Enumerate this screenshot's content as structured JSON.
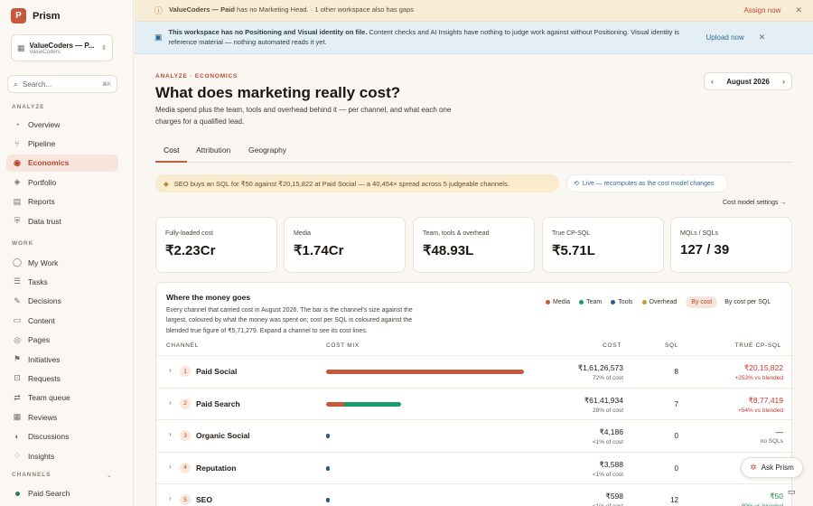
{
  "app": {
    "name": "Prism",
    "logo_letter": "P"
  },
  "workspace": {
    "name": "ValueCoders — P...",
    "sub": "ValueCoders"
  },
  "search": {
    "placeholder": "Search...",
    "shortcut": "⌘K"
  },
  "sidebar": {
    "analyze_label": "ANALYZE",
    "analyze": [
      {
        "label": "Overview",
        "icon": "overview-icon",
        "glyph": "◔"
      },
      {
        "label": "Pipeline",
        "icon": "pipeline-icon",
        "glyph": "⑂"
      },
      {
        "label": "Economics",
        "icon": "economics-icon",
        "glyph": "◉",
        "active": true
      },
      {
        "label": "Portfolio",
        "icon": "portfolio-icon",
        "glyph": "◈"
      },
      {
        "label": "Reports",
        "icon": "reports-icon",
        "glyph": "▤"
      },
      {
        "label": "Data trust",
        "icon": "shield-icon",
        "glyph": "⛨"
      }
    ],
    "work_label": "WORK",
    "work": [
      {
        "label": "My Work",
        "icon": "user-icon",
        "glyph": "◯"
      },
      {
        "label": "Tasks",
        "icon": "tasks-icon",
        "glyph": "☰"
      },
      {
        "label": "Decisions",
        "icon": "decisions-icon",
        "glyph": "✎"
      },
      {
        "label": "Content",
        "icon": "content-icon",
        "glyph": "▭"
      },
      {
        "label": "Pages",
        "icon": "pages-icon",
        "glyph": "◎"
      },
      {
        "label": "Initiatives",
        "icon": "initiatives-icon",
        "glyph": "⚑"
      },
      {
        "label": "Requests",
        "icon": "requests-icon",
        "glyph": "⊡"
      },
      {
        "label": "Team queue",
        "icon": "team-queue-icon",
        "glyph": "⇄"
      },
      {
        "label": "Reviews",
        "icon": "reviews-icon",
        "glyph": "▦"
      },
      {
        "label": "Discussions",
        "icon": "discussions-icon",
        "glyph": "◐"
      },
      {
        "label": "Insights",
        "icon": "insights-icon",
        "glyph": "♢"
      }
    ],
    "channels_label": "CHANNELS",
    "channels": [
      {
        "label": "Paid Search",
        "color": "#2f7d5a"
      }
    ]
  },
  "banners": {
    "warning": {
      "bold": "ValueCoders — Paid",
      "text": " has no Marketing Head. · 1 other workspace also has gaps",
      "action": "Assign now",
      "icon": "warning-icon"
    },
    "info": {
      "bold": "This workspace has no Positioning and Visual identity on file.",
      "text": " Content checks and AI Insights have nothing to judge work against without Positioning. Visual identity is reference material — nothing automated reads it yet.",
      "action": "Upload now",
      "icon": "info-icon"
    }
  },
  "page": {
    "breadcrumb": "ANALYZE · ECONOMICS",
    "title": "What does marketing really cost?",
    "subtitle": "Media spend plus the team, tools and overhead behind it — per channel, and what each one charges for a qualified lead.",
    "month": "August 2026"
  },
  "tabs": [
    "Cost",
    "Attribution",
    "Geography"
  ],
  "insight": "SEO buys an SQL for ₹50 against ₹20,15,822 at Paid Social — a 40,454× spread across 5 judgeable channels.",
  "live": "Live — recomputes as the cost model changes",
  "cost_model_link": "Cost model settings →",
  "kpis": [
    {
      "label": "Fully-loaded cost",
      "value": "₹2.23Cr"
    },
    {
      "label": "Media",
      "value": "₹1.74Cr"
    },
    {
      "label": "Team, tools & overhead",
      "value": "₹48.93L"
    },
    {
      "label": "True CP-SQL",
      "value": "₹5.71L"
    },
    {
      "label": "MQLs / SQLs",
      "value": "127 / 39"
    }
  ],
  "money": {
    "title": "Where the money goes",
    "desc": "Every channel that carried cost in August 2026. The bar is the channel's size against the largest, coloured by what the money was spent on; cost per SQL is coloured against the blended true figure of ₹5,71,279. Expand a channel to see its cost lines.",
    "legend": [
      {
        "label": "Media",
        "color": "#c8583c"
      },
      {
        "label": "Team",
        "color": "#1d9a6c"
      },
      {
        "label": "Tools",
        "color": "#1f5f8f"
      },
      {
        "label": "Overhead",
        "color": "#c89a2e"
      }
    ],
    "toggle": [
      "By cost",
      "By cost per SQL"
    ],
    "headers": {
      "channel": "CHANNEL",
      "mix": "COST MIX",
      "cost": "COST",
      "sql": "SQL",
      "cpsql": "TRUE CP-SQL"
    }
  },
  "channels_table": [
    {
      "rank": "1",
      "name": "Paid Social",
      "cost": "₹1,61,26,573",
      "pct": "72% of cost",
      "sql": "8",
      "cpsql": "₹20,15,822",
      "cpsql_sub": "+253% vs blended",
      "status": "bad"
    },
    {
      "rank": "2",
      "name": "Paid Search",
      "cost": "₹61,41,934",
      "pct": "28% of cost",
      "sql": "7",
      "cpsql": "₹8,77,419",
      "cpsql_sub": "+54% vs blended",
      "status": "bad"
    },
    {
      "rank": "3",
      "name": "Organic Social",
      "cost": "₹4,186",
      "pct": "<1% of cost",
      "sql": "0",
      "cpsql": "—",
      "cpsql_sub": "no SQLs",
      "status": "none"
    },
    {
      "rank": "4",
      "name": "Reputation",
      "cost": "₹3,588",
      "pct": "<1% of cost",
      "sql": "0",
      "cpsql": "",
      "cpsql_sub": "",
      "status": "none"
    },
    {
      "rank": "5",
      "name": "SEO",
      "cost": "₹598",
      "pct": "<1% of cost",
      "sql": "12",
      "cpsql": "₹50",
      "cpsql_sub": "-99% vs blended",
      "status": "good"
    }
  ],
  "cost_mix": [
    [
      {
        "share": 1.0,
        "color": "#c8583c"
      }
    ],
    [
      {
        "share": 0.24,
        "color": "#c8583c"
      },
      {
        "share": 0.76,
        "color": "#1d9a6c"
      }
    ],
    [
      {
        "share": 1.0,
        "color": "#1f5f8f"
      }
    ],
    [
      {
        "share": 1.0,
        "color": "#1f5f8f"
      }
    ],
    [
      {
        "share": 1.0,
        "color": "#1f5f8f"
      }
    ]
  ],
  "cost_mix_scale": [
    1.0,
    0.38,
    0.01,
    0.01,
    0.01
  ],
  "ask_prism": "Ask Prism"
}
